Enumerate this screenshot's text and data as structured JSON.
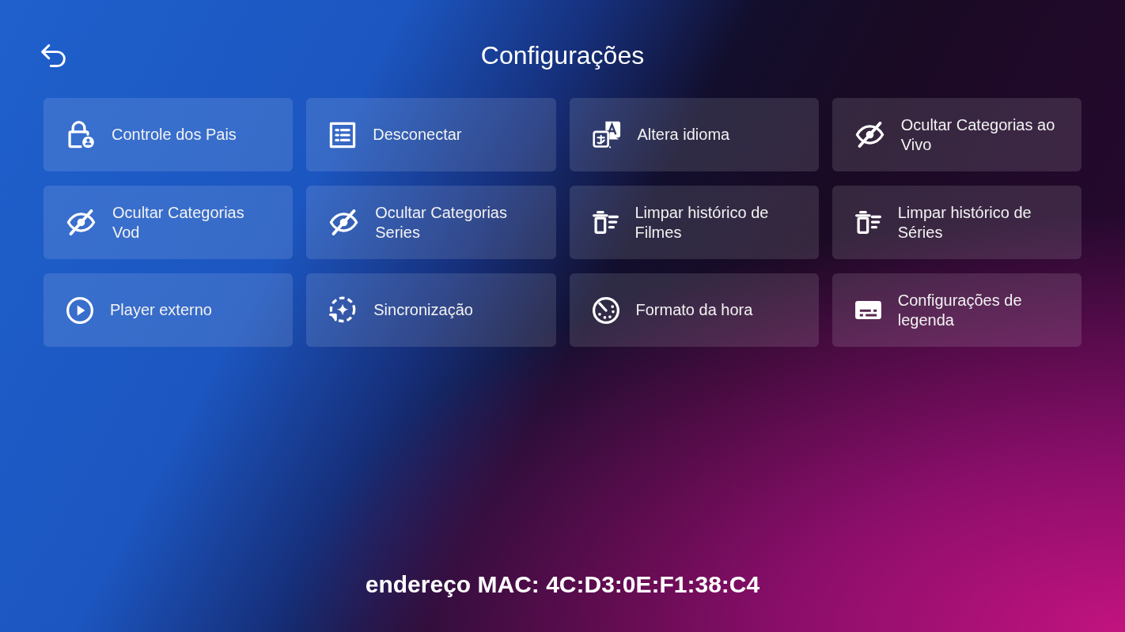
{
  "header": {
    "title": "Configurações"
  },
  "settings": [
    {
      "label": "Controle dos Pais"
    },
    {
      "label": "Desconectar"
    },
    {
      "label": "Altera idioma"
    },
    {
      "label": "Ocultar Categorias ao Vivo"
    },
    {
      "label": "Ocultar Categorias Vod"
    },
    {
      "label": "Ocultar Categorias Series"
    },
    {
      "label": "Limpar histórico de Filmes"
    },
    {
      "label": "Limpar histórico de Séries"
    },
    {
      "label": "Player externo"
    },
    {
      "label": "Sincronização"
    },
    {
      "label": "Formato da hora"
    },
    {
      "label": "Configurações de legenda"
    }
  ],
  "footer": {
    "mac_address": "endereço MAC: 4C:D3:0E:F1:38:C4"
  }
}
